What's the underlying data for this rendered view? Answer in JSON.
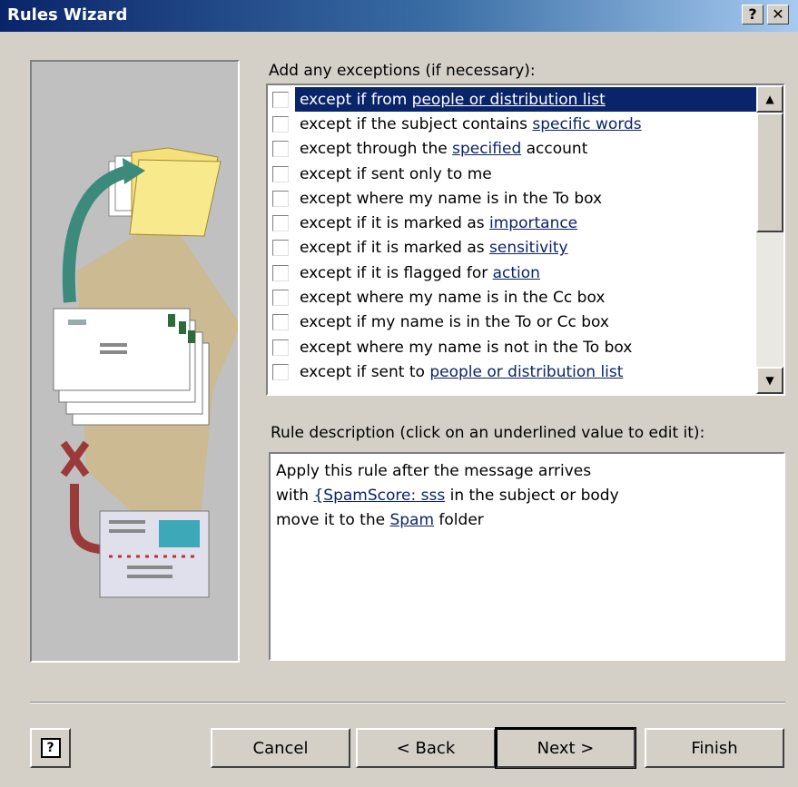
{
  "window": {
    "title": "Rules Wizard",
    "help_glyph": "?",
    "close_glyph": "✕"
  },
  "exceptions_label": "Add any exceptions (if necessary):",
  "exceptions": [
    {
      "pre": "except if from ",
      "link": "people or distribution list",
      "post": "",
      "checked": false,
      "selected": true
    },
    {
      "pre": "except if the subject contains ",
      "link": "specific words",
      "post": "",
      "checked": false,
      "selected": false
    },
    {
      "pre": "except through the ",
      "link": "specified",
      "post": " account",
      "checked": false,
      "selected": false
    },
    {
      "pre": "except if sent only to me",
      "link": "",
      "post": "",
      "checked": false,
      "selected": false
    },
    {
      "pre": "except where my name is in the To box",
      "link": "",
      "post": "",
      "checked": false,
      "selected": false
    },
    {
      "pre": "except if it is marked as ",
      "link": "importance",
      "post": "",
      "checked": false,
      "selected": false
    },
    {
      "pre": "except if it is marked as ",
      "link": "sensitivity",
      "post": "",
      "checked": false,
      "selected": false
    },
    {
      "pre": "except if it is flagged for ",
      "link": "action",
      "post": "",
      "checked": false,
      "selected": false
    },
    {
      "pre": "except where my name is in the Cc box",
      "link": "",
      "post": "",
      "checked": false,
      "selected": false
    },
    {
      "pre": "except if my name is in the To or Cc box",
      "link": "",
      "post": "",
      "checked": false,
      "selected": false
    },
    {
      "pre": "except where my name is not in the To box",
      "link": "",
      "post": "",
      "checked": false,
      "selected": false
    },
    {
      "pre": "except if sent to ",
      "link": "people or distribution list",
      "post": "",
      "checked": false,
      "selected": false
    }
  ],
  "description_label": "Rule description (click on an underlined value to edit it):",
  "description": {
    "line1": "Apply this rule after the message arrives",
    "line2_pre": "with ",
    "line2_link": "{SpamScore: sss",
    "line2_post": " in the subject or body",
    "line3_pre": "move it to the ",
    "line3_link": "Spam",
    "line3_post": " folder"
  },
  "buttons": {
    "help": "?",
    "cancel": "Cancel",
    "back": "< Back",
    "next": "Next >",
    "finish": "Finish"
  },
  "scrollbar": {
    "up_glyph": "▲",
    "down_glyph": "▼"
  },
  "colors": {
    "title_bar": "#0a246a",
    "link": "#0a246a",
    "dialog_bg": "#d4d0c8"
  }
}
